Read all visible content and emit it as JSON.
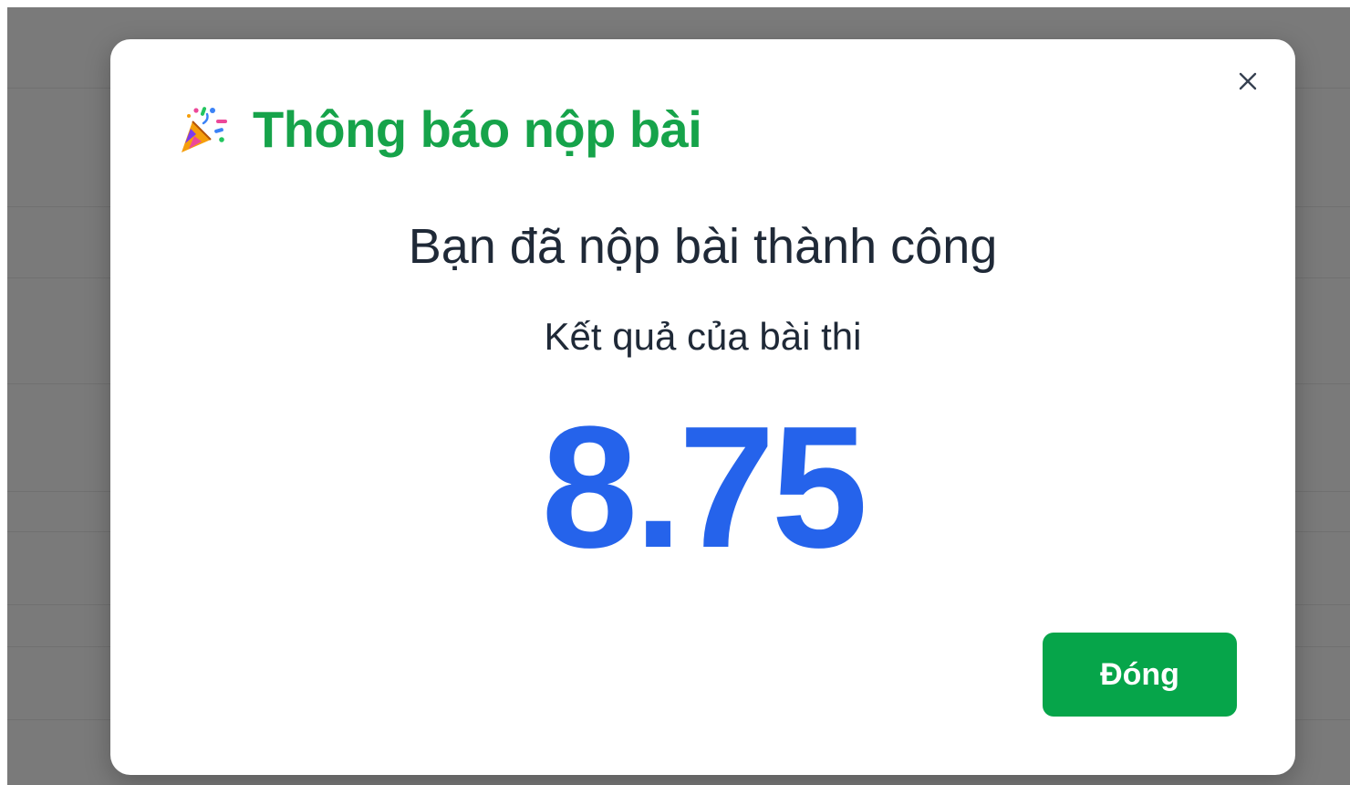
{
  "colors": {
    "title": "#16a34a",
    "score": "#2563eb",
    "button": "#06a54a",
    "text": "#1f2937",
    "backdrop": "#7a7a7a"
  },
  "modal": {
    "title_icon": "party-popper-icon",
    "title": "Thông báo nộp bài",
    "close_icon": "close-icon",
    "message": "Bạn đã nộp bài thành công",
    "subtitle": "Kết quả của bài thi",
    "score": "8.75",
    "close_button_label": "Đóng"
  }
}
